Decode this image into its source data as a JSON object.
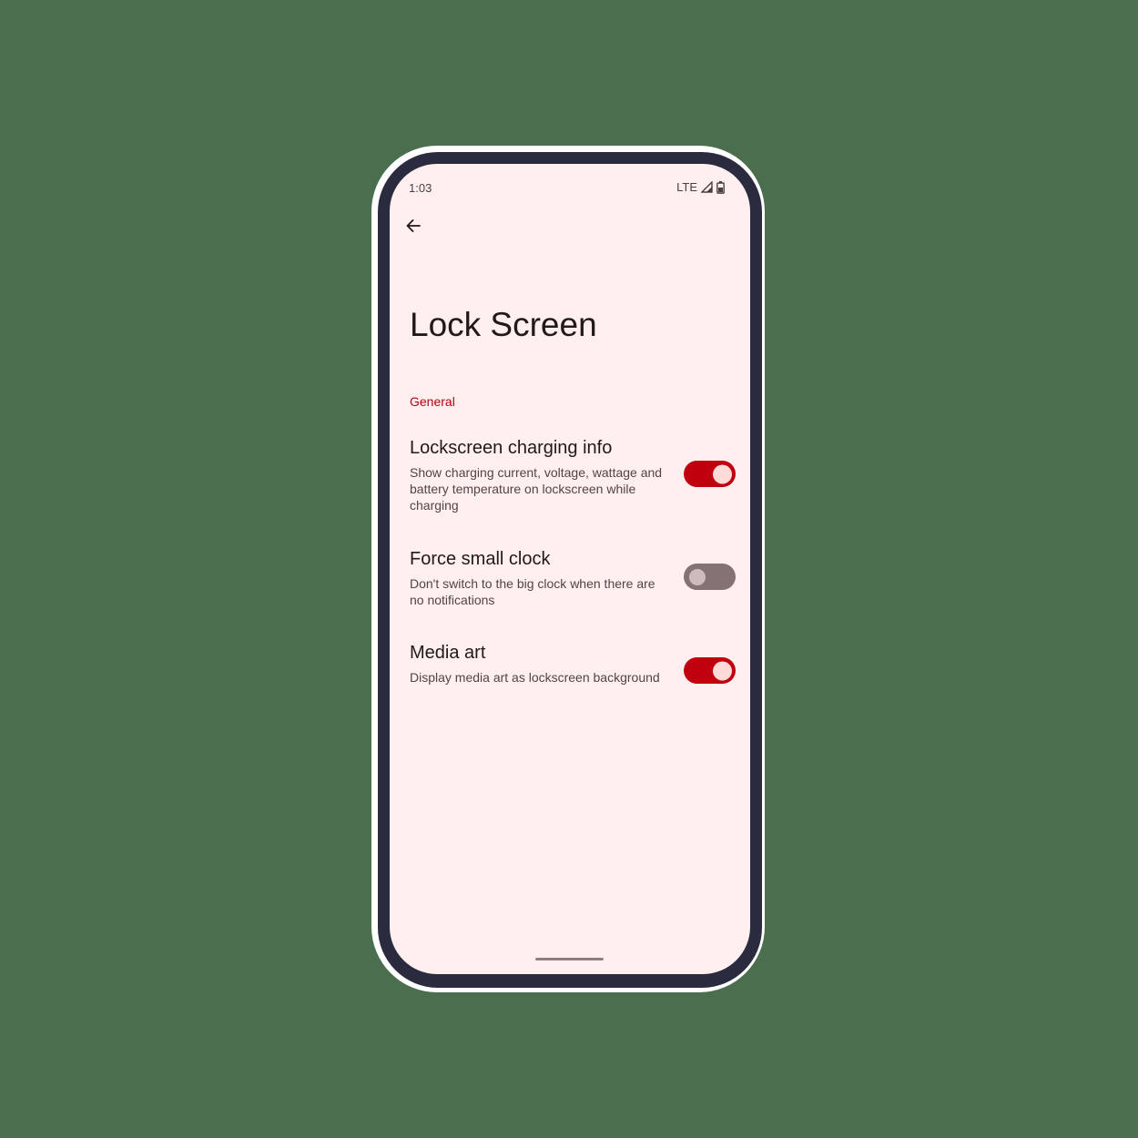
{
  "status_bar": {
    "time": "1:03",
    "network": "LTE",
    "signal_icon": "cell-signal-icon",
    "battery_icon": "battery-icon"
  },
  "toolbar": {
    "back_icon": "arrow-back-icon"
  },
  "page": {
    "title": "Lock Screen"
  },
  "sections": [
    {
      "header": "General",
      "items": [
        {
          "title": "Lockscreen charging info",
          "summary": "Show charging current, voltage, wattage and battery temperature on lockscreen while charging",
          "enabled": true
        },
        {
          "title": "Force small clock",
          "summary": "Don't switch to the big clock when there are no notifications",
          "enabled": false
        },
        {
          "title": "Media art",
          "summary": "Display media art as lockscreen background",
          "enabled": true
        }
      ]
    }
  ],
  "colors": {
    "accent": "#c0000f",
    "screen_background": "#fff0ef",
    "toggle_off_track": "#857373",
    "phone_frame": "#2b2b40",
    "page_background": "#4a6e4e"
  }
}
